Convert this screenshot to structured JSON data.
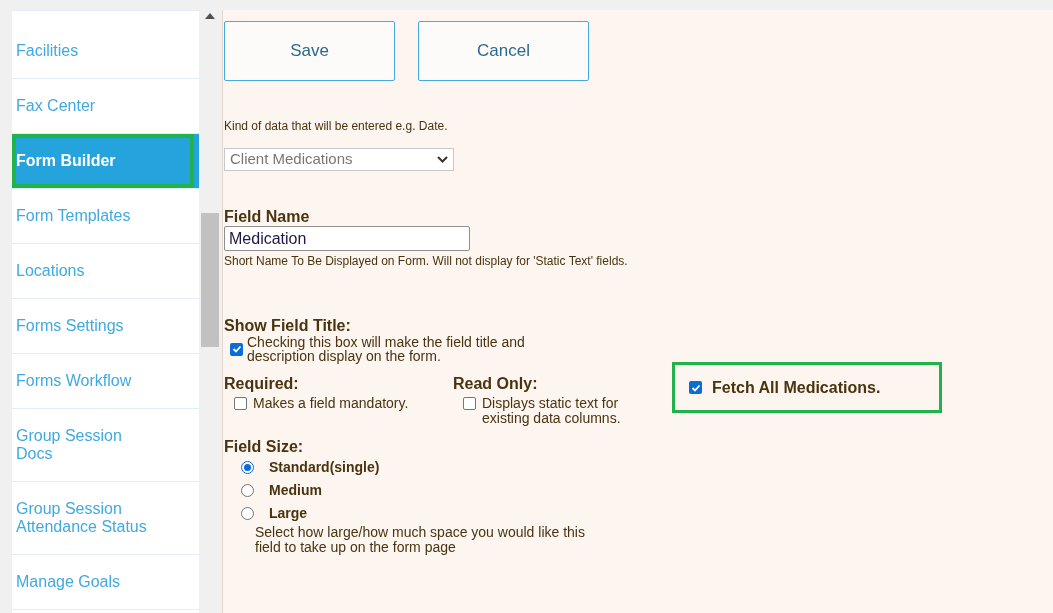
{
  "sidebar": {
    "items": [
      {
        "label": "Facilities",
        "selected": false,
        "highlighted": false
      },
      {
        "label": "Fax Center",
        "selected": false,
        "highlighted": false
      },
      {
        "label": "Form Builder",
        "selected": true,
        "highlighted": true
      },
      {
        "label": "Form Templates",
        "selected": false,
        "highlighted": false
      },
      {
        "label": "Locations",
        "selected": false,
        "highlighted": false
      },
      {
        "label": "Forms Settings",
        "selected": false,
        "highlighted": false
      },
      {
        "label": "Forms Workflow",
        "selected": false,
        "highlighted": false
      },
      {
        "label": "Group Session Docs",
        "selected": false,
        "highlighted": false
      },
      {
        "label": "Group Session Attendance Status",
        "selected": false,
        "highlighted": false
      },
      {
        "label": "Manage Goals",
        "selected": false,
        "highlighted": false
      }
    ]
  },
  "buttons": [
    "Save",
    "Cancel"
  ],
  "data_type": {
    "hint": "Kind of data that will be entered e.g. Date.",
    "value": "Client Medications"
  },
  "field_name": {
    "label": "Field Name",
    "value": "Medication",
    "hint": "Short Name To Be Displayed on Form. Will not display for 'Static Text' fields."
  },
  "show_field_title": {
    "label": "Show Field Title:",
    "checked": true,
    "description": "Checking this box will make the field title and description display on the form."
  },
  "required": {
    "label": "Required:",
    "checked": false,
    "description": "Makes a field mandatory."
  },
  "read_only": {
    "label": "Read Only:",
    "checked": false,
    "description": "Displays static text for existing data columns."
  },
  "fetch_all": {
    "label": "Fetch All Medications.",
    "checked": true,
    "highlighted": true
  },
  "field_size": {
    "label": "Field Size:",
    "options": [
      {
        "label": "Standard(single)",
        "selected": true
      },
      {
        "label": "Medium",
        "selected": false
      },
      {
        "label": "Large",
        "selected": false
      }
    ],
    "description": "Select how large/how much space you would like this field to take up on the form page"
  }
}
